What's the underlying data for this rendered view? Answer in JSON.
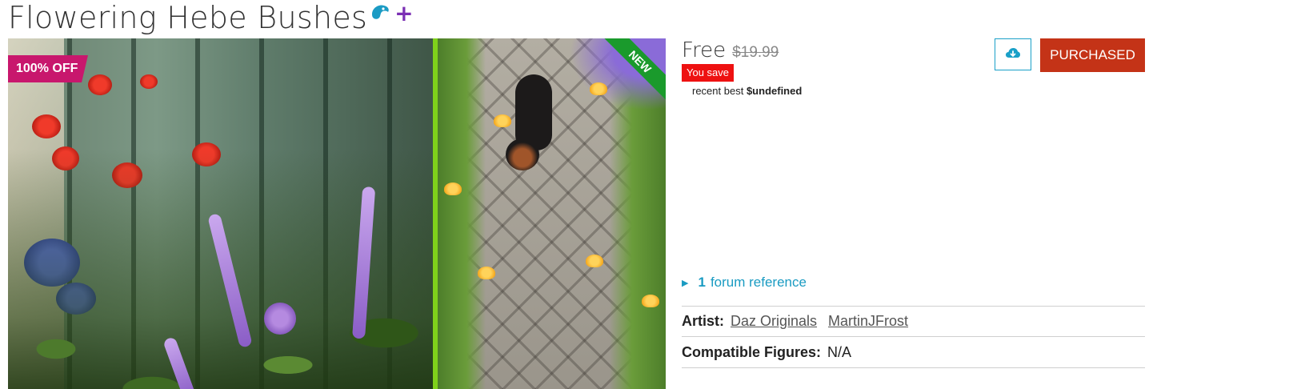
{
  "product": {
    "title": "Flowering Hebe Bushes",
    "plus_symbol": "+",
    "icons": [
      "daz-logo-icon",
      "plus-icon"
    ]
  },
  "image": {
    "discount_badge": "100% OFF",
    "new_ribbon": "NEW"
  },
  "pricing": {
    "price": "Free",
    "original_price": "$19.99",
    "you_save": "You save",
    "recent_best_prefix": "recent best",
    "recent_best_value": "$undefined"
  },
  "actions": {
    "download_icon": "cloud-download-icon",
    "purchased_label": "PURCHASED"
  },
  "forum": {
    "count": "1",
    "label": "forum reference"
  },
  "details": {
    "artist_label": "Artist:",
    "artists": [
      "Daz Originals",
      "MartinJFrost"
    ],
    "compatible_figures_label": "Compatible Figures:",
    "compatible_figures_value": "N/A"
  },
  "colors": {
    "purchased_button": "#c43317",
    "accent_link": "#1a9bc2",
    "discount_badge": "#c8176d",
    "new_ribbon": "#1a9a2c",
    "you_save_bg": "#ee1111",
    "plus": "#7b2fb4"
  }
}
